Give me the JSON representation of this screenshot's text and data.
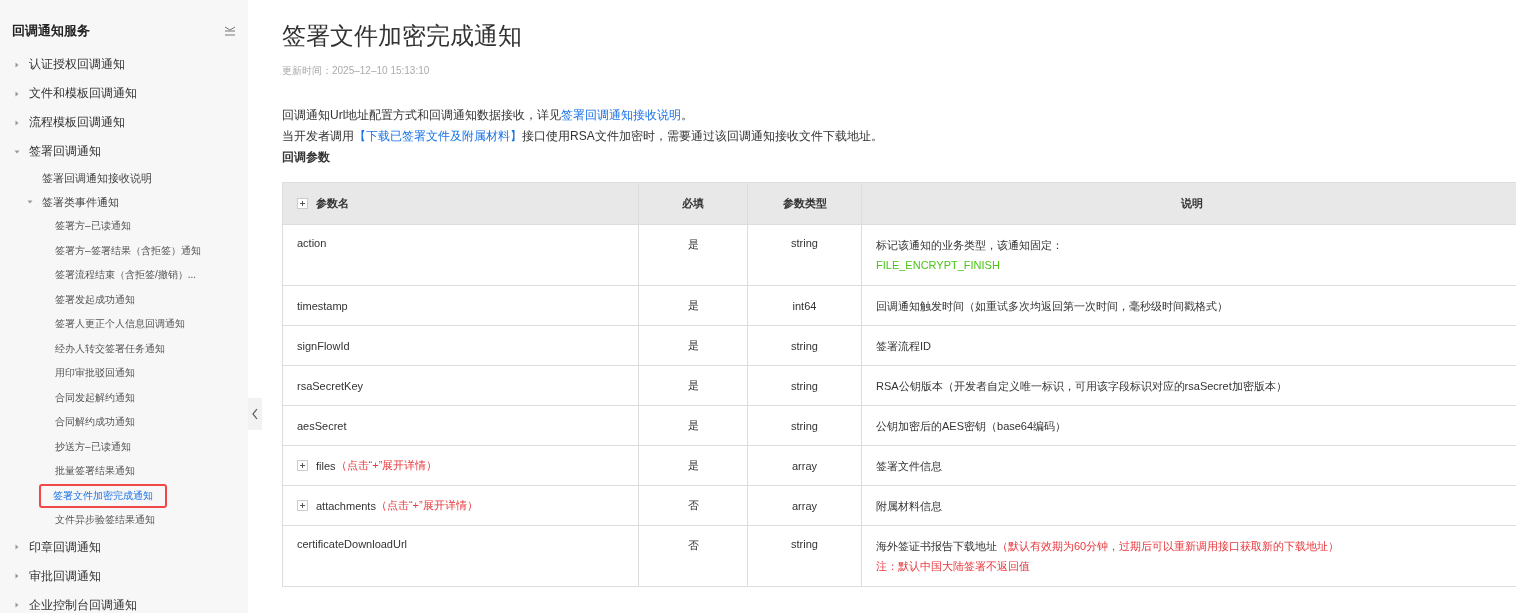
{
  "sidebar": {
    "title": "回调通知服务",
    "items": [
      {
        "label": "认证授权回调通知",
        "selected": false,
        "expanded": false
      },
      {
        "label": "文件和模板回调通知",
        "selected": false,
        "expanded": false
      },
      {
        "label": "流程模板回调通知",
        "selected": false,
        "expanded": false
      },
      {
        "label": "签署回调通知",
        "selected": false,
        "expanded": true,
        "children": [
          {
            "label": "签署回调通知接收说明",
            "selected": false
          },
          {
            "label": "签署类事件通知",
            "selected": false,
            "expanded": true,
            "children": [
              {
                "label": "签署方–已读通知",
                "selected": false
              },
              {
                "label": "签署方–签署结果（含拒签）通知",
                "selected": false
              },
              {
                "label": "签署流程结束（含拒签/撤销）...",
                "selected": false
              },
              {
                "label": "签署发起成功通知",
                "selected": false
              },
              {
                "label": "签署人更正个人信息回调通知",
                "selected": false
              },
              {
                "label": "经办人转交签署任务通知",
                "selected": false
              },
              {
                "label": "用印审批驳回通知",
                "selected": false
              },
              {
                "label": "合同发起解约通知",
                "selected": false
              },
              {
                "label": "合同解约成功通知",
                "selected": false
              },
              {
                "label": "抄送方–已读通知",
                "selected": false
              },
              {
                "label": "批量签署结果通知",
                "selected": false
              },
              {
                "label": "签署文件加密完成通知",
                "selected": true
              },
              {
                "label": "文件异步验签结果通知",
                "selected": false
              }
            ]
          }
        ]
      },
      {
        "label": "印章回调通知",
        "selected": false,
        "expanded": false
      },
      {
        "label": "审批回调通知",
        "selected": false,
        "expanded": false
      },
      {
        "label": "企业控制台回调通知",
        "selected": false,
        "expanded": false
      }
    ]
  },
  "article": {
    "title": "签署文件加密完成通知",
    "updated": "更新时间：2025–12–10 15:13:10",
    "paragraphs": [
      {
        "before": "回调通知Url地址配置方式和回调通知数据接收，详见",
        "link": "签署回调通知接收说明",
        "after": "。"
      },
      {
        "before": "当开发者调用",
        "link": "【下载已签署文件及附属材料】",
        "after": "接口使用RSA文件加密时，需要通过该回调通知接收文件下载地址。"
      }
    ],
    "section_heading": "回调参数"
  },
  "table": {
    "columns": [
      "参数名",
      "必填",
      "参数类型",
      "说明"
    ],
    "rows": [
      {
        "name": "action",
        "expandable": false,
        "required": "是",
        "type": "string",
        "description": "标记该通知的业务类型，该通知固定：",
        "extra": [
          {
            "kind": "code",
            "text": "FILE_ENCRYPT_FINISH"
          }
        ]
      },
      {
        "name": "timestamp",
        "expandable": false,
        "required": "是",
        "type": "int64",
        "description": "回调通知触发时间（如重试多次均返回第一次时间，毫秒级时间戳格式）"
      },
      {
        "name": "signFlowId",
        "expandable": false,
        "required": "是",
        "type": "string",
        "description": "签署流程ID"
      },
      {
        "name": "rsaSecretKey",
        "expandable": false,
        "required": "是",
        "type": "string",
        "description": "RSA公钥版本（开发者自定义唯一标识，可用该字段标识对应的rsaSecret加密版本）"
      },
      {
        "name": "aesSecret",
        "expandable": false,
        "required": "是",
        "type": "string",
        "description": "公钥加密后的AES密钥（base64编码）"
      },
      {
        "name": "files",
        "expandable": true,
        "hint": "（点击“+”展开详情）",
        "required": "是",
        "type": "array",
        "description": "签署文件信息"
      },
      {
        "name": "attachments",
        "expandable": true,
        "hint": "（点击“+”展开详情）",
        "required": "否",
        "type": "array",
        "description": "附属材料信息"
      },
      {
        "name": "certificateDownloadUrl",
        "expandable": false,
        "required": "否",
        "type": "string",
        "description": "海外签证书报告下载地址",
        "description_note": "（默认有效期为60分钟，过期后可以重新调用接口获取新的下载地址）",
        "extra": [
          {
            "kind": "warning",
            "text": "注：默认中国大陆签署不返回值"
          }
        ]
      }
    ]
  }
}
